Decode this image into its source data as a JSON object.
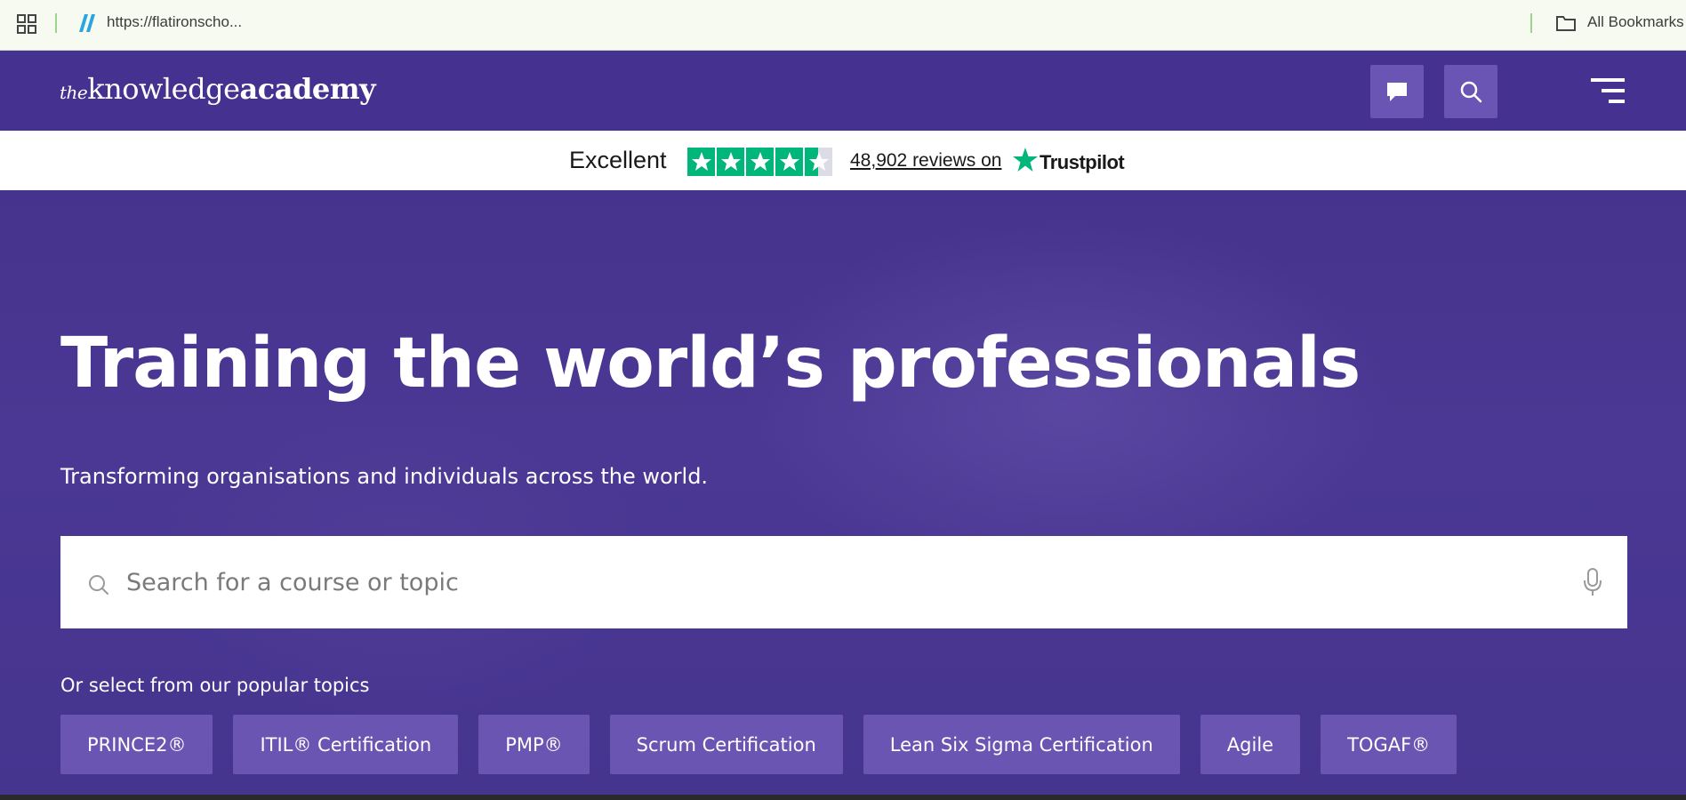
{
  "browser": {
    "url": "https://flatironscho...",
    "bookmarks_folder": "All Bookmarks",
    "icons": [
      "apps-grid-icon",
      "favicon-icon",
      "folder-icon"
    ]
  },
  "header": {
    "logo": {
      "the": "the",
      "knowledge": "knowledge",
      "academy": "academy"
    },
    "icons": [
      "chat-icon",
      "search-icon",
      "hamburger-menu-icon"
    ]
  },
  "trustpilot": {
    "rating_word": "Excellent",
    "stars": 4.5,
    "reviews_text": "48,902 reviews on",
    "brand": "Trustpilot",
    "color": "#00b67a"
  },
  "hero": {
    "title": "Training the world’s professionals",
    "subtitle": "Transforming organisations and individuals across the world.",
    "search_placeholder": "Search for a course or topic",
    "topics_label": "Or select from our popular topics",
    "topics": [
      "PRINCE2®",
      "ITIL® Certification",
      "PMP®",
      "Scrum Certification",
      "Lean Six Sigma Certification",
      "Agile",
      "TOGAF®"
    ]
  },
  "colors": {
    "header_bg": "#45318f",
    "hero_bg": "#46358f",
    "button_bg": "#6a55b2"
  }
}
